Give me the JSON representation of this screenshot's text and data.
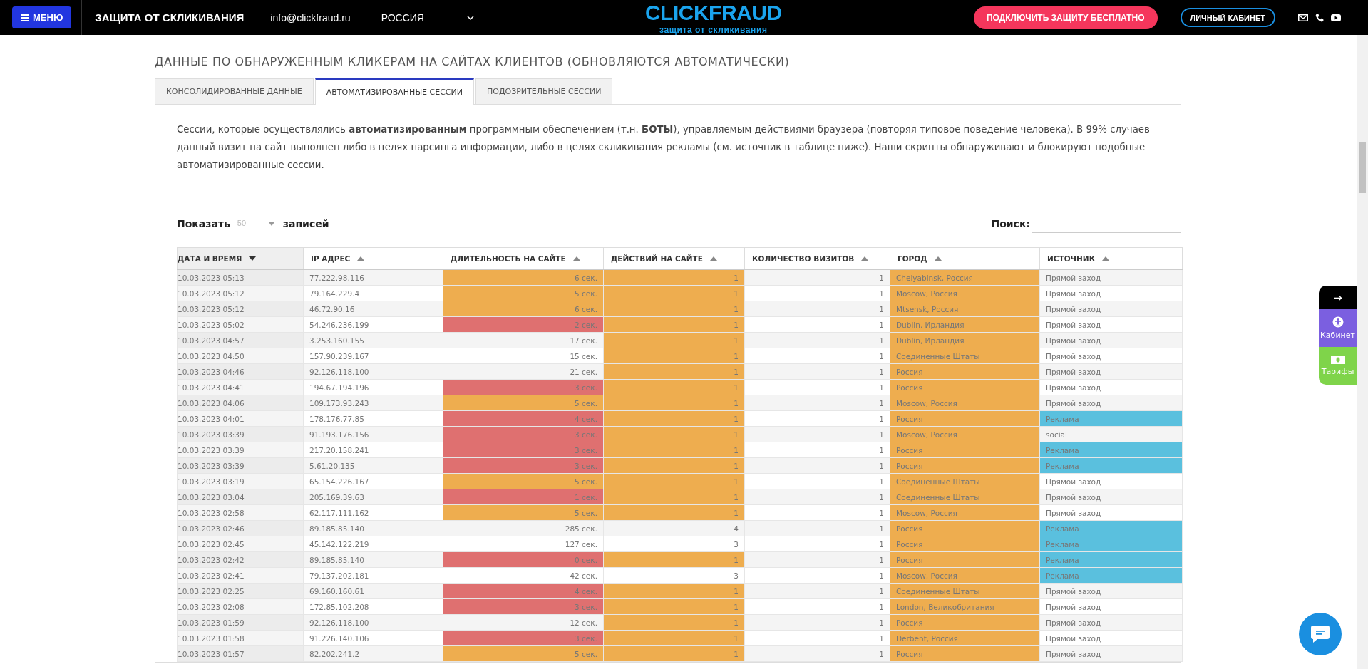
{
  "top_bar": {
    "menu_button": "МЕНЮ",
    "tagline": "ЗАЩИТА ОТ СКЛИКИВАНИЯ",
    "email": "info@clickfraud.ru",
    "region": "РОССИЯ",
    "logo": "CLICKFRAUD",
    "logo_subtitle": "защита от скликивания",
    "cta_button": "ПОДКЛЮЧИТЬ ЗАЩИТУ БЕСПЛАТНО",
    "account_button": "ЛИЧНЫЙ КАБИНЕТ"
  },
  "heading": "ДАННЫЕ ПО ОБНАРУЖЕННЫМ КЛИКЕРАМ НА САЙТАХ КЛИЕНТОВ (ОБНОВЛЯЮТСЯ АВТОМАТИЧЕСКИ)",
  "tabs": [
    {
      "label": "КОНСОЛИДИРОВАННЫЕ ДАННЫЕ",
      "selected": false
    },
    {
      "label": "АВТОМАТИЗИРОВАННЫЕ СЕССИИ",
      "selected": true
    },
    {
      "label": "ПОДОЗРИТЕЛЬНЫЕ СЕССИИ",
      "selected": false
    }
  ],
  "description": "Сессии, которые осуществлялись **автоматизированным** программным обеспечением (т.н. **БОТЫ**), управляемым действиями браузера (повторяя типовое поведение человека). В 99% случаев данный визит на сайт выполнен либо в целях парсинга информации, либо в целях скликивания рекламы (см. источник в таблице ниже). Наши скрипты обнаруживают и блокируют подобные автоматизированные сессии.",
  "length_control": {
    "label_before": "Показать",
    "placeholder": "50",
    "label_after": "записей"
  },
  "search": {
    "label": "Поиск:"
  },
  "table": {
    "columns": [
      {
        "label": "ДАТА И ВРЕМЯ",
        "sorted": true
      },
      {
        "label": "IP АДРЕС",
        "sorted": false
      },
      {
        "label": "ДЛИТЕЛЬНОСТЬ НА САЙТЕ",
        "sorted": false
      },
      {
        "label": "ДЕЙСТВИЙ НА САЙТЕ",
        "sorted": false
      },
      {
        "label": "КОЛИЧЕСТВО ВИЗИТОВ",
        "sorted": false
      },
      {
        "label": "ГОРОД",
        "sorted": false
      },
      {
        "label": "ИСТОЧНИК",
        "sorted": false
      }
    ],
    "rows": [
      {
        "date": "10.03.2023 05:13",
        "ip": "77.222.98.116",
        "duration": {
          "text": "6 сек.",
          "color": "#eead4f"
        },
        "actions": {
          "text": "1",
          "color": "#eead4f"
        },
        "visits": "1",
        "city": {
          "text": "Chelyabinsk, Россия",
          "color": "#eead4f"
        },
        "source": {
          "text": "Прямой заход"
        }
      },
      {
        "date": "10.03.2023 05:12",
        "ip": "79.164.229.4",
        "duration": {
          "text": "5 сек.",
          "color": "#eead4f"
        },
        "actions": {
          "text": "1",
          "color": "#eead4f"
        },
        "visits": "1",
        "city": {
          "text": "Moscow, Россия",
          "color": "#eead4f"
        },
        "source": {
          "text": "Прямой заход"
        }
      },
      {
        "date": "10.03.2023 05:12",
        "ip": "46.72.90.16",
        "duration": {
          "text": "6 сек.",
          "color": "#eead4f"
        },
        "actions": {
          "text": "1",
          "color": "#eead4f"
        },
        "visits": "1",
        "city": {
          "text": "Mtsensk, Россия",
          "color": "#eead4f"
        },
        "source": {
          "text": "Прямой заход"
        }
      },
      {
        "date": "10.03.2023 05:02",
        "ip": "54.246.236.199",
        "duration": {
          "text": "2 сек.",
          "color": "#df7070"
        },
        "actions": {
          "text": "1",
          "color": "#eead4f"
        },
        "visits": "1",
        "city": {
          "text": "Dublin, Ирландия",
          "color": "#eead4f"
        },
        "source": {
          "text": "Прямой заход"
        }
      },
      {
        "date": "10.03.2023 04:57",
        "ip": "3.253.160.155",
        "duration": {
          "text": "17 сек."
        },
        "actions": {
          "text": "1",
          "color": "#eead4f"
        },
        "visits": "1",
        "city": {
          "text": "Dublin, Ирландия",
          "color": "#eead4f"
        },
        "source": {
          "text": "Прямой заход"
        }
      },
      {
        "date": "10.03.2023 04:50",
        "ip": "157.90.239.167",
        "duration": {
          "text": "15 сек."
        },
        "actions": {
          "text": "1",
          "color": "#eead4f"
        },
        "visits": "1",
        "city": {
          "text": "Соединенные Штаты",
          "color": "#eead4f"
        },
        "source": {
          "text": "Прямой заход"
        }
      },
      {
        "date": "10.03.2023 04:46",
        "ip": "92.126.118.100",
        "duration": {
          "text": "21 сек."
        },
        "actions": {
          "text": "1",
          "color": "#eead4f"
        },
        "visits": "1",
        "city": {
          "text": "Россия",
          "color": "#eead4f"
        },
        "source": {
          "text": "Прямой заход"
        }
      },
      {
        "date": "10.03.2023 04:41",
        "ip": "194.67.194.196",
        "duration": {
          "text": "3 сек.",
          "color": "#df7070"
        },
        "actions": {
          "text": "1",
          "color": "#eead4f"
        },
        "visits": "1",
        "city": {
          "text": "Россия",
          "color": "#eead4f"
        },
        "source": {
          "text": "Прямой заход"
        }
      },
      {
        "date": "10.03.2023 04:06",
        "ip": "109.173.93.243",
        "duration": {
          "text": "5 сек.",
          "color": "#eead4f"
        },
        "actions": {
          "text": "1",
          "color": "#eead4f"
        },
        "visits": "1",
        "city": {
          "text": "Moscow, Россия",
          "color": "#eead4f"
        },
        "source": {
          "text": "Прямой заход"
        }
      },
      {
        "date": "10.03.2023 04:01",
        "ip": "178.176.77.85",
        "duration": {
          "text": "4 сек.",
          "color": "#df7070"
        },
        "actions": {
          "text": "1",
          "color": "#eead4f"
        },
        "visits": "1",
        "city": {
          "text": "Россия",
          "color": "#eead4f"
        },
        "source": {
          "text": "Реклама",
          "color": "#5ac0de"
        }
      },
      {
        "date": "10.03.2023 03:39",
        "ip": "91.193.176.156",
        "duration": {
          "text": "3 сек.",
          "color": "#df7070"
        },
        "actions": {
          "text": "1",
          "color": "#eead4f"
        },
        "visits": "1",
        "city": {
          "text": "Moscow, Россия",
          "color": "#eead4f"
        },
        "source": {
          "text": "social"
        }
      },
      {
        "date": "10.03.2023 03:39",
        "ip": "217.20.158.241",
        "duration": {
          "text": "3 сек.",
          "color": "#df7070"
        },
        "actions": {
          "text": "1",
          "color": "#eead4f"
        },
        "visits": "1",
        "city": {
          "text": "Россия",
          "color": "#eead4f"
        },
        "source": {
          "text": "Реклама",
          "color": "#5ac0de"
        }
      },
      {
        "date": "10.03.2023 03:39",
        "ip": "5.61.20.135",
        "duration": {
          "text": "3 сек.",
          "color": "#df7070"
        },
        "actions": {
          "text": "1",
          "color": "#eead4f"
        },
        "visits": "1",
        "city": {
          "text": "Россия",
          "color": "#eead4f"
        },
        "source": {
          "text": "Реклама",
          "color": "#5ac0de"
        }
      },
      {
        "date": "10.03.2023 03:19",
        "ip": "65.154.226.167",
        "duration": {
          "text": "5 сек.",
          "color": "#eead4f"
        },
        "actions": {
          "text": "1",
          "color": "#eead4f"
        },
        "visits": "1",
        "city": {
          "text": "Соединенные Штаты",
          "color": "#eead4f"
        },
        "source": {
          "text": "Прямой заход"
        }
      },
      {
        "date": "10.03.2023 03:04",
        "ip": "205.169.39.63",
        "duration": {
          "text": "1 сек.",
          "color": "#df7070"
        },
        "actions": {
          "text": "1",
          "color": "#eead4f"
        },
        "visits": "1",
        "city": {
          "text": "Соединенные Штаты",
          "color": "#eead4f"
        },
        "source": {
          "text": "Прямой заход"
        }
      },
      {
        "date": "10.03.2023 02:58",
        "ip": "62.117.111.162",
        "duration": {
          "text": "5 сек.",
          "color": "#eead4f"
        },
        "actions": {
          "text": "1",
          "color": "#eead4f"
        },
        "visits": "1",
        "city": {
          "text": "Moscow, Россия",
          "color": "#eead4f"
        },
        "source": {
          "text": "Прямой заход"
        }
      },
      {
        "date": "10.03.2023 02:46",
        "ip": "89.185.85.140",
        "duration": {
          "text": "285 сек."
        },
        "actions": {
          "text": "4"
        },
        "visits": "1",
        "city": {
          "text": "Россия",
          "color": "#eead4f"
        },
        "source": {
          "text": "Реклама",
          "color": "#5ac0de"
        }
      },
      {
        "date": "10.03.2023 02:45",
        "ip": "45.142.122.219",
        "duration": {
          "text": "127 сек."
        },
        "actions": {
          "text": "3"
        },
        "visits": "1",
        "city": {
          "text": "Россия",
          "color": "#eead4f"
        },
        "source": {
          "text": "Реклама",
          "color": "#5ac0de"
        }
      },
      {
        "date": "10.03.2023 02:42",
        "ip": "89.185.85.140",
        "duration": {
          "text": "0 сек.",
          "color": "#df7070"
        },
        "actions": {
          "text": "1",
          "color": "#eead4f"
        },
        "visits": "1",
        "city": {
          "text": "Россия",
          "color": "#eead4f"
        },
        "source": {
          "text": "Реклама",
          "color": "#5ac0de"
        }
      },
      {
        "date": "10.03.2023 02:41",
        "ip": "79.137.202.181",
        "duration": {
          "text": "42 сек."
        },
        "actions": {
          "text": "3"
        },
        "visits": "1",
        "city": {
          "text": "Moscow, Россия",
          "color": "#eead4f"
        },
        "source": {
          "text": "Реклама",
          "color": "#5ac0de"
        }
      },
      {
        "date": "10.03.2023 02:25",
        "ip": "69.160.160.61",
        "duration": {
          "text": "4 сек.",
          "color": "#df7070"
        },
        "actions": {
          "text": "1",
          "color": "#eead4f"
        },
        "visits": "1",
        "city": {
          "text": "Соединенные Штаты",
          "color": "#eead4f"
        },
        "source": {
          "text": "Прямой заход"
        }
      },
      {
        "date": "10.03.2023 02:08",
        "ip": "172.85.102.208",
        "duration": {
          "text": "3 сек.",
          "color": "#df7070"
        },
        "actions": {
          "text": "1",
          "color": "#eead4f"
        },
        "visits": "1",
        "city": {
          "text": "London, Великобритания",
          "color": "#eead4f"
        },
        "source": {
          "text": "Прямой заход"
        }
      },
      {
        "date": "10.03.2023 01:59",
        "ip": "92.126.118.100",
        "duration": {
          "text": "12 сек."
        },
        "actions": {
          "text": "1",
          "color": "#eead4f"
        },
        "visits": "1",
        "city": {
          "text": "Россия",
          "color": "#eead4f"
        },
        "source": {
          "text": "Прямой заход"
        }
      },
      {
        "date": "10.03.2023 01:58",
        "ip": "91.226.140.106",
        "duration": {
          "text": "3 сек.",
          "color": "#df7070"
        },
        "actions": {
          "text": "1",
          "color": "#eead4f"
        },
        "visits": "1",
        "city": {
          "text": "Derbent, Россия",
          "color": "#eead4f"
        },
        "source": {
          "text": "Прямой заход"
        }
      },
      {
        "date": "10.03.2023 01:57",
        "ip": "82.202.241.2",
        "duration": {
          "text": "5 сек.",
          "color": "#eead4f"
        },
        "actions": {
          "text": "1",
          "color": "#eead4f"
        },
        "visits": "1",
        "city": {
          "text": "Россия",
          "color": "#eead4f"
        },
        "source": {
          "text": "Прямой заход"
        }
      }
    ]
  },
  "side_widget": {
    "arrow": "→",
    "cabinet": "Кабинет",
    "tariffs": "Тарифы"
  }
}
